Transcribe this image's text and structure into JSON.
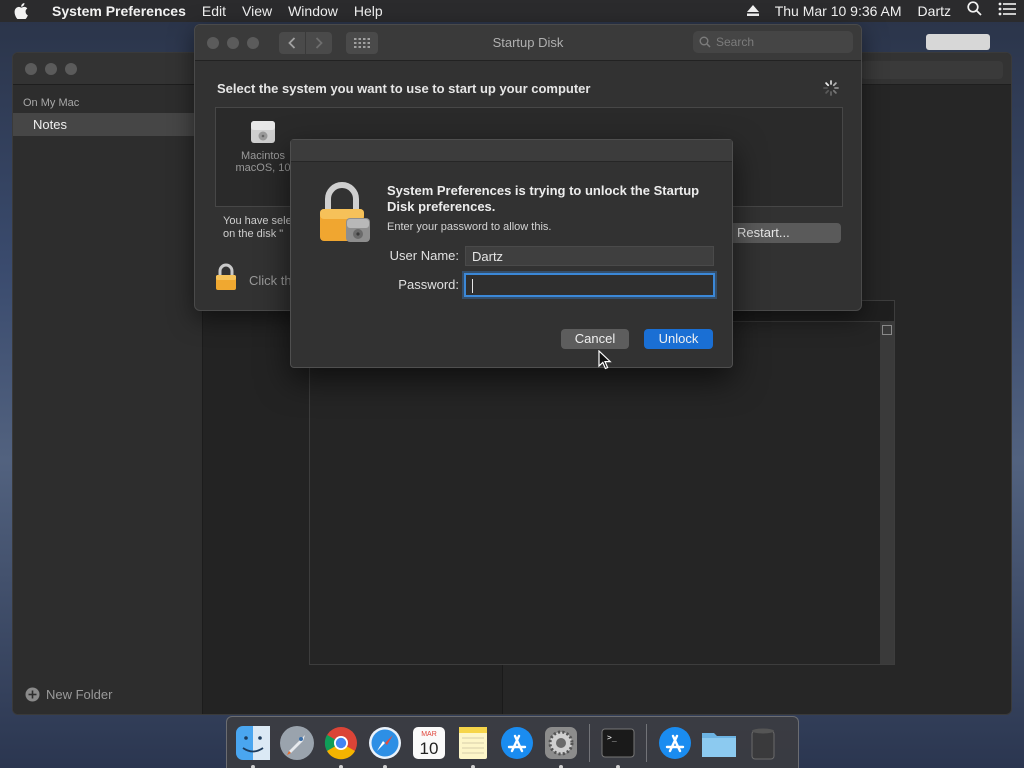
{
  "menubar": {
    "app_name": "System Preferences",
    "menus": [
      "Edit",
      "View",
      "Window",
      "Help"
    ],
    "datetime": "Thu Mar 10  9:36 AM",
    "user": "Dartz",
    "icons": [
      "apple-icon",
      "eject-icon",
      "spotlight-icon",
      "control-strip-icon"
    ]
  },
  "notes": {
    "section": "On My Mac",
    "folder": "Notes",
    "new_folder": "New Folder"
  },
  "startup": {
    "title": "Startup Disk",
    "search_placeholder": "Search",
    "heading": "Select the system you want to use to start up your computer",
    "disk_name": "Macintos",
    "disk_os": "macOS, 10",
    "note_line1": "You have sele",
    "note_line2": "on the disk \"",
    "restart_label": "Restart...",
    "lock_text": "Click th"
  },
  "dialog": {
    "message": "System Preferences is trying to unlock the Startup Disk preferences.",
    "sub": "Enter your password to allow this.",
    "username_label": "User Name:",
    "username_value": "Dartz",
    "password_label": "Password:",
    "password_value": "",
    "cancel_label": "Cancel",
    "unlock_label": "Unlock"
  },
  "dock": {
    "apps": [
      "Finder",
      "Launchpad",
      "Chrome",
      "Safari",
      "Calendar",
      "Notes",
      "App Store",
      "System Preferences",
      "Terminal",
      "Downloads",
      "Documents",
      "Trash"
    ],
    "calendar_month": "MAR",
    "calendar_day": "10"
  }
}
